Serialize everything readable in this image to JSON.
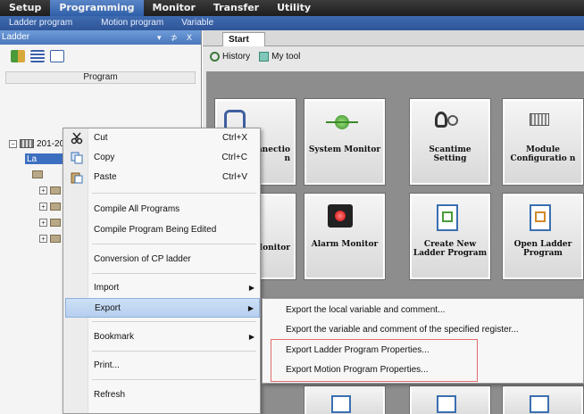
{
  "menubar": {
    "items": [
      "Setup",
      "Programming",
      "Monitor",
      "Transfer",
      "Utility"
    ],
    "active": "Programming"
  },
  "submenu": {
    "items": [
      "Ladder program",
      "Motion program",
      "Variable"
    ]
  },
  "left_pane": {
    "title": "Ladder",
    "controls": "▾ ⊅ X",
    "program_header": "Program",
    "tree_root": "201-20180105 [CPU-201]",
    "selected_node": "La"
  },
  "context_menu": {
    "cut": {
      "label": "Cut",
      "shortcut": "Ctrl+X"
    },
    "copy": {
      "label": "Copy",
      "shortcut": "Ctrl+C"
    },
    "paste": {
      "label": "Paste",
      "shortcut": "Ctrl+V"
    },
    "compile_all": "Compile All Programs",
    "compile_edited": "Compile Program Being Edited",
    "conversion": "Conversion of CP ladder",
    "import": "Import",
    "export": "Export",
    "bookmark": "Bookmark",
    "print": "Print...",
    "refresh": "Refresh"
  },
  "export_submenu": {
    "items": [
      "Export the local variable and comment...",
      "Export the variable and comment of the specified register...",
      "Export Ladder Program Properties...",
      "Export Motion Program Properties..."
    ]
  },
  "start_tab": {
    "tab_label": "Start",
    "toolbar": {
      "history": "History",
      "mytool": "My tool"
    },
    "tiles": [
      {
        "label": "ction / nnectio n"
      },
      {
        "label": "System Monitor"
      },
      {
        "label": "Scantime Setting"
      },
      {
        "label": "Module Configuratio n"
      },
      {
        "label": "Monitor"
      },
      {
        "label": "Alarm Monitor"
      },
      {
        "label": "Create New Ladder Program"
      },
      {
        "label": "Open Ladder Program"
      }
    ]
  },
  "colors": {
    "menubar_bg": "#2b2b2b",
    "menubar_active": "#3f6bb0",
    "submenu_bg": "#3466ac",
    "highlight": "#b6cfee",
    "red_outline": "#e36c6c"
  }
}
